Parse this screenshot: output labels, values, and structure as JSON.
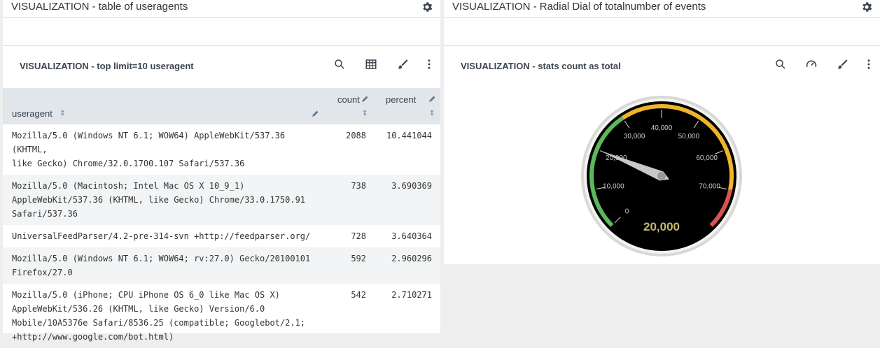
{
  "left_panel": {
    "title": "VISUALIZATION - table of useragents",
    "icon": "gear-icon",
    "viz": {
      "title": "VISUALIZATION - top limit=10 useragent",
      "tools": [
        "search-icon",
        "table-icon",
        "brush-icon",
        "more-vertical-icon"
      ]
    },
    "table": {
      "columns": [
        {
          "label": "useragent",
          "sort": "⇕"
        },
        {
          "label": "count",
          "sort": "⇕"
        },
        {
          "label": "percent",
          "sort": "⇕"
        }
      ],
      "rows": [
        {
          "ua": [
            "Mozilla/5.0 (Windows NT 6.1; WOW64) AppleWebKit/537.36 (KHTML,",
            "like Gecko) Chrome/32.0.1700.107 Safari/537.36"
          ],
          "count": "2088",
          "percent": "10.441044"
        },
        {
          "ua": [
            "Mozilla/5.0 (Macintosh; Intel Mac OS X 10_9_1)",
            "AppleWebKit/537.36 (KHTML, like Gecko) Chrome/33.0.1750.91",
            "Safari/537.36"
          ],
          "count": "738",
          "percent": "3.690369"
        },
        {
          "ua": [
            "UniversalFeedParser/4.2-pre-314-svn +http://feedparser.org/"
          ],
          "count": "728",
          "percent": "3.640364"
        },
        {
          "ua": [
            "Mozilla/5.0 (Windows NT 6.1; WOW64; rv:27.0) Gecko/20100101",
            "Firefox/27.0"
          ],
          "count": "592",
          "percent": "2.960296"
        },
        {
          "ua": [
            "Mozilla/5.0 (iPhone; CPU iPhone OS 6_0 like Mac OS X)",
            "AppleWebKit/536.26 (KHTML, like Gecko) Version/6.0",
            "Mobile/10A5376e Safari/8536.25 (compatible; Googlebot/2.1;",
            "+http://www.google.com/bot.html)"
          ],
          "count": "542",
          "percent": "2.710271"
        }
      ]
    }
  },
  "right_panel": {
    "title": "VISUALIZATION - Radial Dial of totalnumber of events",
    "icon": "gear-icon",
    "viz": {
      "title": "VISUALIZATION - stats count as total",
      "tools": [
        "search-icon",
        "gauge-icon",
        "brush-icon",
        "more-vertical-icon"
      ]
    },
    "gauge": {
      "value": 20000,
      "value_label": "20,000",
      "min": 0,
      "max": 80000,
      "tick_labels": [
        "0",
        "10,000",
        "20,000",
        "30,000",
        "40,000",
        "50,000",
        "60,000",
        "70,000"
      ],
      "ranges": [
        {
          "from": 0,
          "to": 30000,
          "color": "#5cb85c"
        },
        {
          "from": 30000,
          "to": 70000,
          "color": "#f0b429"
        },
        {
          "from": 70000,
          "to": 80000,
          "color": "#d9534f"
        }
      ],
      "value_color": "#c9b76b"
    }
  }
}
